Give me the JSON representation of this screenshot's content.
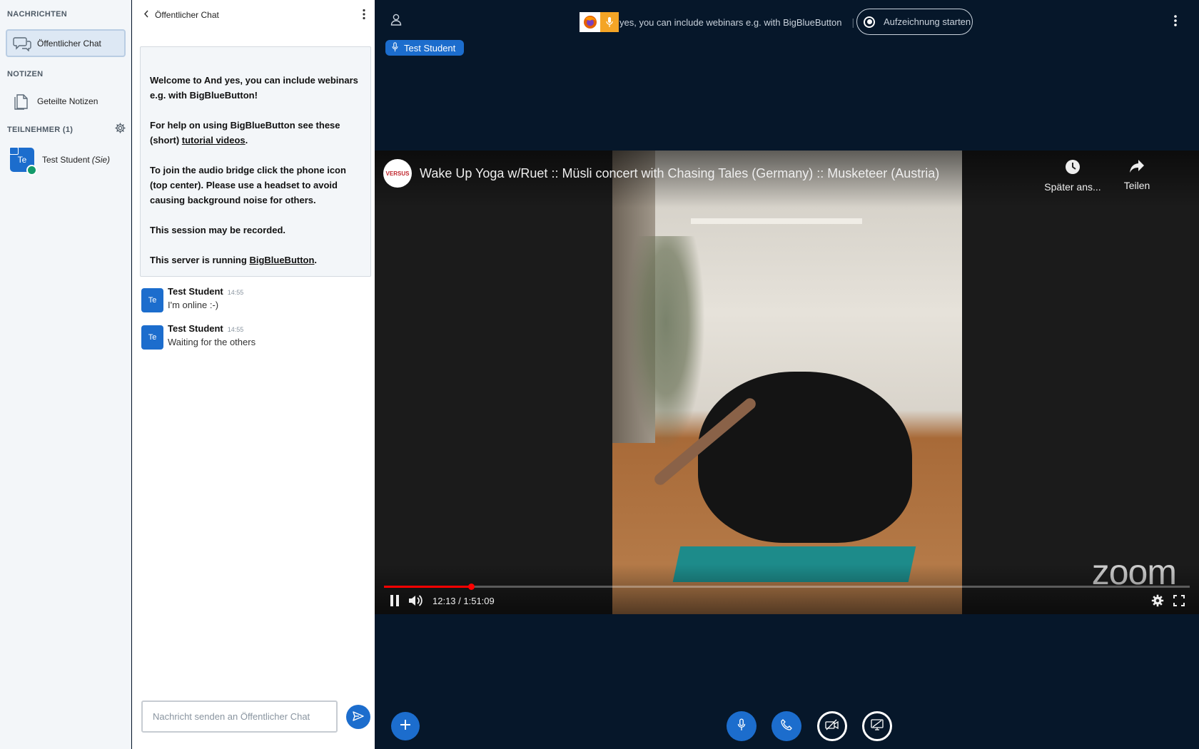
{
  "sidebar": {
    "messages_title": "NACHRICHTEN",
    "public_chat_label": "Öffentlicher Chat",
    "notes_title": "NOTIZEN",
    "shared_notes_label": "Geteilte Notizen",
    "users_title": "TEILNEHMER (1)",
    "users": [
      {
        "initials": "Te",
        "name": "Test Student",
        "suffix": "(Sie)"
      }
    ]
  },
  "chat": {
    "header_title": "Öffentlicher Chat",
    "welcome": {
      "p1_prefix": "Welcome to ",
      "p1_bold": "And yes, you can include webinars e.g. with BigBlueButton",
      "p1_suffix": "!",
      "p2_prefix": "For help on using BigBlueButton see these (short) ",
      "p2_link": "tutorial videos",
      "p2_suffix": ".",
      "p3_prefix": "To join the audio bridge click the phone icon (top center). ",
      "p3_bold": "Please use a headset to avoid causing background noise for others.",
      "p4": "This session may be recorded.",
      "p5_prefix": "This server is running ",
      "p5_link": "BigBlueButton",
      "p5_suffix": "."
    },
    "messages": [
      {
        "initials": "Te",
        "author": "Test Student",
        "time": "14:55",
        "text": "I'm online :-)"
      },
      {
        "initials": "Te",
        "author": "Test Student",
        "time": "14:55",
        "text": "Waiting for the others"
      }
    ],
    "input_placeholder": "Nachricht senden an Öffentlicher Chat"
  },
  "main": {
    "meeting_title": "yes, you can include webinars e.g. with BigBlueButton",
    "record_label": "Aufzeichnung starten",
    "talker_name": "Test Student"
  },
  "video": {
    "channel_badge": "VERSUS",
    "title": "Wake Up Yoga w/Ruet :: Müsli concert with Chasing Tales (Germany) :: Musketeer (Austria)",
    "watch_later_label": "Später ans...",
    "share_label": "Teilen",
    "time_display": "12:13 / 1:51:09",
    "progress_fraction": 0.108,
    "watermark": "zoom"
  },
  "colors": {
    "accent": "#1c6dcd",
    "main_bg": "#06172a",
    "recording_active": "#f4a526",
    "progress": "#ff0000"
  }
}
